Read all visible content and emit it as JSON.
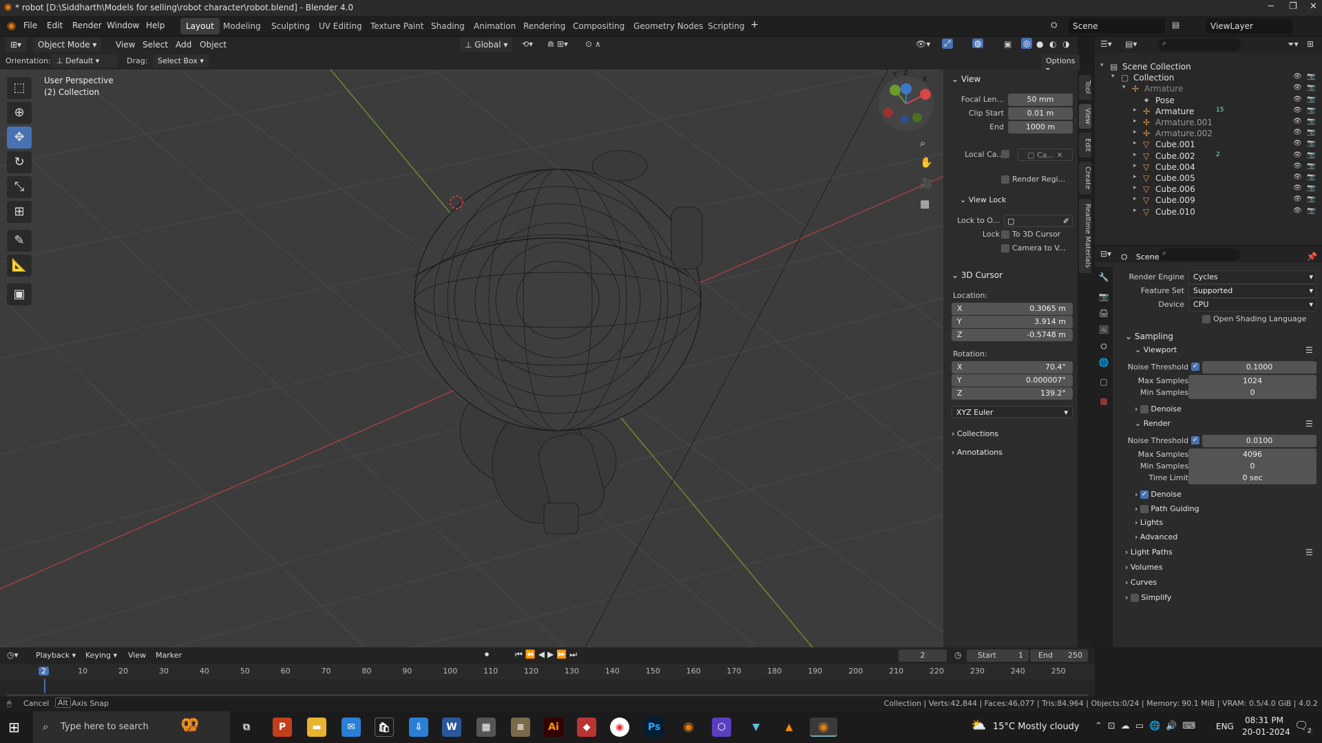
{
  "window": {
    "title": "* robot [D:\\Siddharth\\Models for selling\\robot character\\robot.blend] - Blender 4.0"
  },
  "menu": [
    "File",
    "Edit",
    "Render",
    "Window",
    "Help"
  ],
  "workspaces": [
    "Layout",
    "Modeling",
    "Sculpting",
    "UV Editing",
    "Texture Paint",
    "Shading",
    "Animation",
    "Rendering",
    "Compositing",
    "Geometry Nodes",
    "Scripting"
  ],
  "active_workspace": "Layout",
  "scene_name": "Scene",
  "view_layer": "ViewLayer",
  "viewport_header": {
    "mode": "Object Mode",
    "menus": [
      "View",
      "Select",
      "Add",
      "Object"
    ],
    "transform": "Global",
    "orientation_label": "Orientation:",
    "orientation": "Default",
    "drag_label": "Drag:",
    "drag": "Select Box",
    "options": "Options"
  },
  "viewport": {
    "info1": "User Perspective",
    "info2": "(2) Collection"
  },
  "npanel": {
    "view_title": "View",
    "focal_label": "Focal Len...",
    "focal": "50 mm",
    "clip_start_label": "Clip Start",
    "clip_start": "0.01 m",
    "end_label": "End",
    "end": "1000 m",
    "local_cam_label": "Local Ca...",
    "local_cam": "Ca...",
    "render_region": "Render Regi...",
    "view_lock": "View Lock",
    "lock_obj_label": "Lock to O...",
    "lock_label": "Lock",
    "to_cursor": "To 3D Cursor",
    "cam_to_view": "Camera to V...",
    "cursor_title": "3D Cursor",
    "location": "Location:",
    "loc": [
      [
        "X",
        "0.3065 m"
      ],
      [
        "Y",
        "3.914 m"
      ],
      [
        "Z",
        "-0.5748 m"
      ]
    ],
    "rotation": "Rotation:",
    "rot": [
      [
        "X",
        "70.4°"
      ],
      [
        "Y",
        "0.000007°"
      ],
      [
        "Z",
        "139.2°"
      ]
    ],
    "euler": "XYZ Euler",
    "collections": "Collections",
    "annotations": "Annotations",
    "tabs": [
      "Tool",
      "View",
      "Edit",
      "Create",
      "Realtime Materials"
    ]
  },
  "outliner": {
    "rows": [
      {
        "label": "Scene Collection",
        "indent": 0,
        "color": "#e0e0e0"
      },
      {
        "label": "Collection",
        "indent": 1,
        "color": "#e0e0e0"
      },
      {
        "label": "Armature",
        "indent": 2,
        "color": "#888"
      },
      {
        "label": "Pose",
        "indent": 3,
        "color": "#e0e0e0"
      },
      {
        "label": "Armature",
        "indent": 3,
        "color": "#e0e0e0",
        "badge": "15"
      },
      {
        "label": "Armature.001",
        "indent": 3,
        "color": "#999"
      },
      {
        "label": "Armature.002",
        "indent": 3,
        "color": "#999"
      },
      {
        "label": "Cube.001",
        "indent": 3,
        "color": "#e0e0e0"
      },
      {
        "label": "Cube.002",
        "indent": 3,
        "color": "#e0e0e0",
        "badge": "2"
      },
      {
        "label": "Cube.004",
        "indent": 3,
        "color": "#e0e0e0"
      },
      {
        "label": "Cube.005",
        "indent": 3,
        "color": "#e0e0e0"
      },
      {
        "label": "Cube.006",
        "indent": 3,
        "color": "#e0e0e0"
      },
      {
        "label": "Cube.009",
        "indent": 3,
        "color": "#e0e0e0"
      },
      {
        "label": "Cube.010",
        "indent": 3,
        "color": "#e0e0e0"
      }
    ]
  },
  "properties": {
    "context": "Scene",
    "render_engine_label": "Render Engine",
    "render_engine": "Cycles",
    "feature_set_label": "Feature Set",
    "feature_set": "Supported",
    "device_label": "Device",
    "device": "CPU",
    "osl": "Open Shading Language",
    "sampling": "Sampling",
    "viewport": "Viewport",
    "noise_label": "Noise Threshold",
    "vp_noise": "0.1000",
    "max_samples_label": "Max Samples",
    "vp_max": "1024",
    "min_samples_label": "Min Samples",
    "vp_min": "0",
    "denoise": "Denoise",
    "render": "Render",
    "r_noise": "0.0100",
    "r_max": "4096",
    "r_min": "0",
    "time_limit_label": "Time Limit",
    "time_limit": "0 sec",
    "path_guiding": "Path Guiding",
    "lights": "Lights",
    "advanced": "Advanced",
    "light_paths": "Light Paths",
    "volumes": "Volumes",
    "curves": "Curves",
    "simplify": "Simplify"
  },
  "timeline": {
    "menus": [
      "Playback",
      "Keying",
      "View",
      "Marker"
    ],
    "current_frame": "2",
    "start_label": "Start",
    "start": "1",
    "end_label": "End",
    "end": "250",
    "ticks": [
      "2",
      "10",
      "20",
      "30",
      "40",
      "50",
      "60",
      "70",
      "80",
      "90",
      "100",
      "110",
      "120",
      "130",
      "140",
      "150",
      "160",
      "170",
      "180",
      "190",
      "200",
      "210",
      "220",
      "230",
      "240",
      "250"
    ]
  },
  "status": {
    "cancel": "Cancel",
    "alt": "Alt",
    "axis_snap": "Axis Snap",
    "stats": "Collection | Verts:42,844 | Faces:46,077 | Tris:84,964 | Objects:0/24 | Memory: 90.1 MiB | VRAM: 0.5/4.0 GiB | 4.0.2"
  },
  "taskbar": {
    "search_placeholder": "Type here to search",
    "weather": "15°C  Mostly cloudy",
    "lang": "ENG",
    "time": "08:31 PM",
    "date": "20-01-2024",
    "notif": "2"
  }
}
